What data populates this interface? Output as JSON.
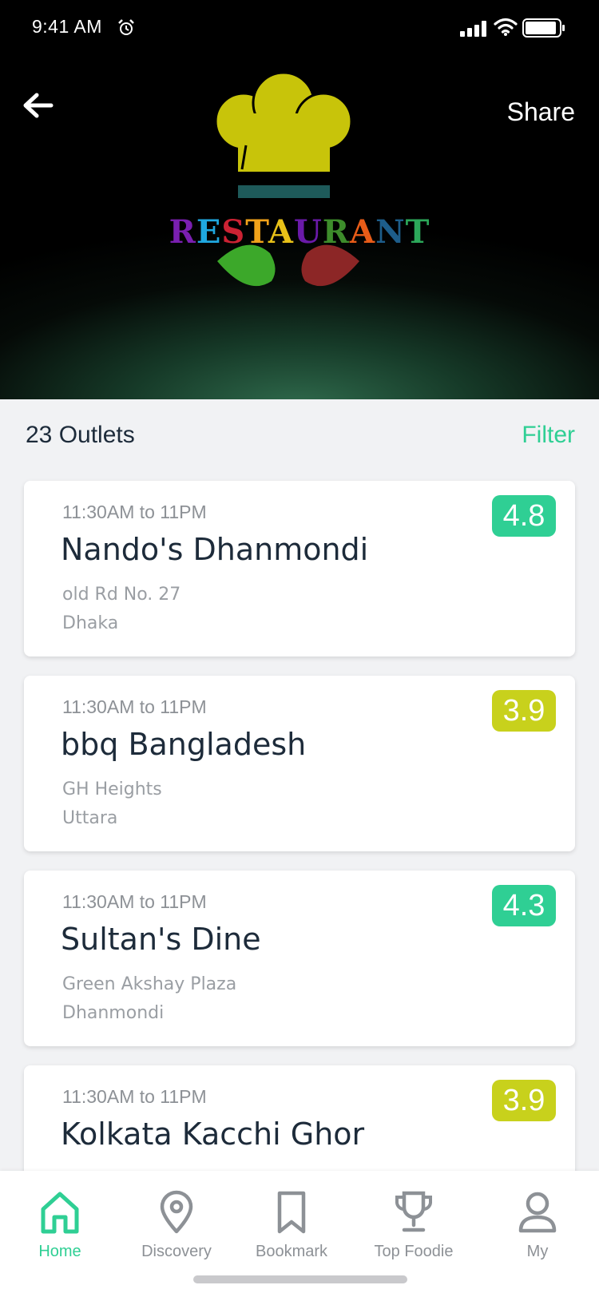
{
  "status_bar": {
    "time": "9:41 AM"
  },
  "header": {
    "share_label": "Share"
  },
  "logo": {
    "letters": [
      {
        "ch": "R",
        "color": "#7a1fb0"
      },
      {
        "ch": "E",
        "color": "#1fa8e0"
      },
      {
        "ch": "S",
        "color": "#cc2233"
      },
      {
        "ch": "T",
        "color": "#f1a21a"
      },
      {
        "ch": "A",
        "color": "#e8c118"
      },
      {
        "ch": "U",
        "color": "#6a1aa8"
      },
      {
        "ch": "R",
        "color": "#3d8c2b"
      },
      {
        "ch": "A",
        "color": "#e85c18"
      },
      {
        "ch": "N",
        "color": "#1d5d8a"
      },
      {
        "ch": "T",
        "color": "#2ca85a"
      }
    ]
  },
  "outlets": {
    "count_label": "23 Outlets",
    "filter_label": "Filter"
  },
  "cards": [
    {
      "hours": "11:30AM to 11PM",
      "name": "Nando's Dhanmondi",
      "address_line1": "old Rd No. 27",
      "address_line2": "Dhaka",
      "rating": "4.8",
      "rating_color": "#2fcf94"
    },
    {
      "hours": "11:30AM to 11PM",
      "name": "bbq Bangladesh",
      "address_line1": "GH Heights",
      "address_line2": "Uttara",
      "rating": "3.9",
      "rating_color": "#c8d11c"
    },
    {
      "hours": "11:30AM to 11PM",
      "name": "Sultan's Dine",
      "address_line1": "Green Akshay Plaza",
      "address_line2": "Dhanmondi",
      "rating": "4.3",
      "rating_color": "#2fcf94"
    },
    {
      "hours": "11:30AM to 11PM",
      "name": "Kolkata Kacchi Ghor",
      "address_line1": "",
      "address_line2": "",
      "rating": "3.9",
      "rating_color": "#c8d11c"
    }
  ],
  "nav": {
    "items": [
      {
        "label": "Home",
        "icon": "home-icon",
        "active": true
      },
      {
        "label": "Discovery",
        "icon": "location-pin-icon",
        "active": false
      },
      {
        "label": "Bookmark",
        "icon": "bookmark-icon",
        "active": false
      },
      {
        "label": "Top Foodie",
        "icon": "trophy-icon",
        "active": false
      },
      {
        "label": "My",
        "icon": "user-icon",
        "active": false
      }
    ]
  },
  "colors": {
    "accent": "#2fcf94",
    "lime": "#c8d11c",
    "text_dark": "#1d2b3a"
  }
}
